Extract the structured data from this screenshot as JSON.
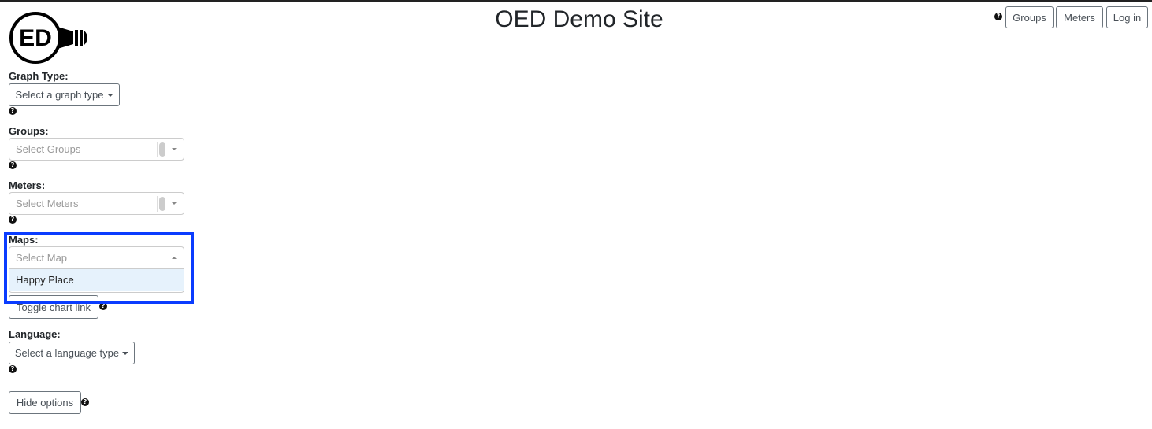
{
  "header": {
    "title": "OED Demo Site",
    "logo_text": "ED",
    "nav": {
      "groups_label": "Groups",
      "meters_label": "Meters",
      "login_label": "Log in"
    }
  },
  "options": {
    "graph_type": {
      "label": "Graph Type:",
      "button": "Select a graph type"
    },
    "groups": {
      "label": "Groups:",
      "placeholder": "Select Groups"
    },
    "meters": {
      "label": "Meters:",
      "placeholder": "Select Meters"
    },
    "maps": {
      "label": "Maps:",
      "placeholder": "Select Map",
      "menu_open": true,
      "options": [
        "Happy Place"
      ]
    },
    "toggle_chart_link": "Toggle chart link",
    "language": {
      "label": "Language:",
      "button": "Select a language type"
    },
    "hide_options": "Hide options"
  },
  "icons": {
    "help": "?"
  },
  "colors": {
    "highlight": "#0a3cff",
    "hover_option": "#e6f2fc"
  }
}
